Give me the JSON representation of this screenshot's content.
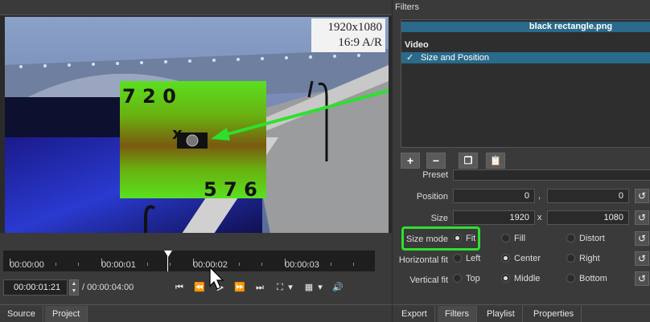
{
  "viewer": {
    "overlay_numbers": {
      "top_left": "7 2 0",
      "bottom_right": "5 7 6",
      "marker": "x"
    },
    "resolution_label": {
      "line1": "1920x1080",
      "line2": "16:9 A/R"
    },
    "colors": {
      "green_arrow": "#2ee02e",
      "green_rect": "#5ad622"
    }
  },
  "timeline": {
    "ticks": [
      "00:00:00",
      "00:00:01",
      "00:00:02",
      "00:00:03"
    ],
    "current_timecode": "00:00:01:21",
    "duration": "/ 00:00:04:00"
  },
  "transport": {
    "icons": [
      "skip-start-icon",
      "rewind-icon",
      "play-icon",
      "fast-forward-icon",
      "skip-end-icon",
      "zoom-fit-icon",
      "grid-icon",
      "volume-icon"
    ]
  },
  "left_tabs": [
    "Source",
    "Project"
  ],
  "filters_panel": {
    "title": "Filters",
    "clip_name": "black rectangle.png",
    "section": "Video",
    "filter_item": {
      "checked": "✓",
      "label": "Size and Position"
    },
    "toolbar": [
      "add-filter-icon",
      "remove-filter-icon",
      "copy-filter-icon",
      "paste-filter-icon"
    ]
  },
  "form": {
    "preset_label": "Preset",
    "position_label": "Position",
    "position_x": "0",
    "position_sep": ",",
    "position_y": "0",
    "size_label": "Size",
    "size_w": "1920",
    "size_sep": "x",
    "size_h": "1080",
    "size_mode_label": "Size mode",
    "size_mode_options": [
      "Fit",
      "Fill",
      "Distort"
    ],
    "size_mode_selected": "Fit",
    "hfit_label": "Horizontal fit",
    "hfit_options": [
      "Left",
      "Center",
      "Right"
    ],
    "hfit_selected": "Center",
    "vfit_label": "Vertical fit",
    "vfit_options": [
      "Top",
      "Middle",
      "Bottom"
    ],
    "vfit_selected": "Middle",
    "reset_glyph": "↺"
  },
  "right_tabs": [
    "Export",
    "Filters",
    "Playlist",
    "Properties"
  ]
}
